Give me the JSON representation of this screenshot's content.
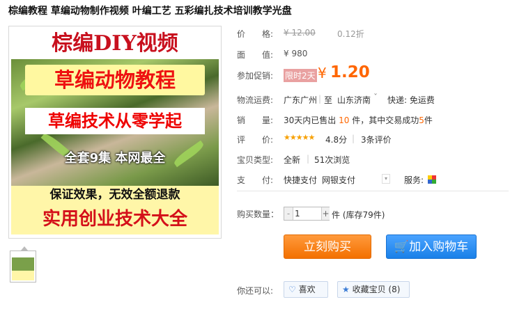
{
  "title": "棕编教程 草编动物制作视频 叶编工艺 五彩编扎技术培训教学光盘",
  "image_text": {
    "line1": "棕编DIY视频",
    "line2": "草编动物教程",
    "line3": "草编技术从零学起",
    "line4": "全套9集  本网最全",
    "line5": "保证效果，无效全额退款",
    "line6": "实用创业技术大全"
  },
  "labels": {
    "price": "价　　格:",
    "face_value": "面　　值:",
    "promo": "参加促销:",
    "shipping": "物流运费:",
    "sales": "销　　量:",
    "rating": "评　　价:",
    "type": "宝贝类型:",
    "payment": "支　　付:",
    "quantity": "购买数量：",
    "also": "你还可以:"
  },
  "price": {
    "original": "¥ 12.00",
    "discount": "0.12折",
    "face": "¥ 980",
    "promo_badge": "限时2天",
    "promo_symbol": "¥",
    "promo_price": "1.20"
  },
  "shipping": {
    "from": "广东广州",
    "sep": "至",
    "to": "山东济南",
    "arrow": "ˇ",
    "method": "快递: 免运费"
  },
  "sales": {
    "prefix": "30天内已售出",
    "count": "10",
    "mid": "件，其中交易成功",
    "success": "5",
    "suffix": "件"
  },
  "rating": {
    "stars": "★★★★★",
    "score": "4.8分",
    "sep": "|",
    "reviews": "3条评价"
  },
  "type": {
    "condition": "全新",
    "sep": "|",
    "views": "51次浏览"
  },
  "payment": {
    "method1": "快捷支付",
    "method2": "网银支付",
    "service_label": "服务:"
  },
  "quantity": {
    "minus": "-",
    "value": "1",
    "plus": "+",
    "stock": "件 (库存79件)"
  },
  "buttons": {
    "buy": "立刻购买",
    "cart": "加入购物车",
    "like": "喜欢",
    "favorite": "收藏宝贝 (8)"
  },
  "colors": {
    "accent_orange": "#f37000",
    "cart_blue": "#1a80e8",
    "promo_red": "#f60"
  }
}
